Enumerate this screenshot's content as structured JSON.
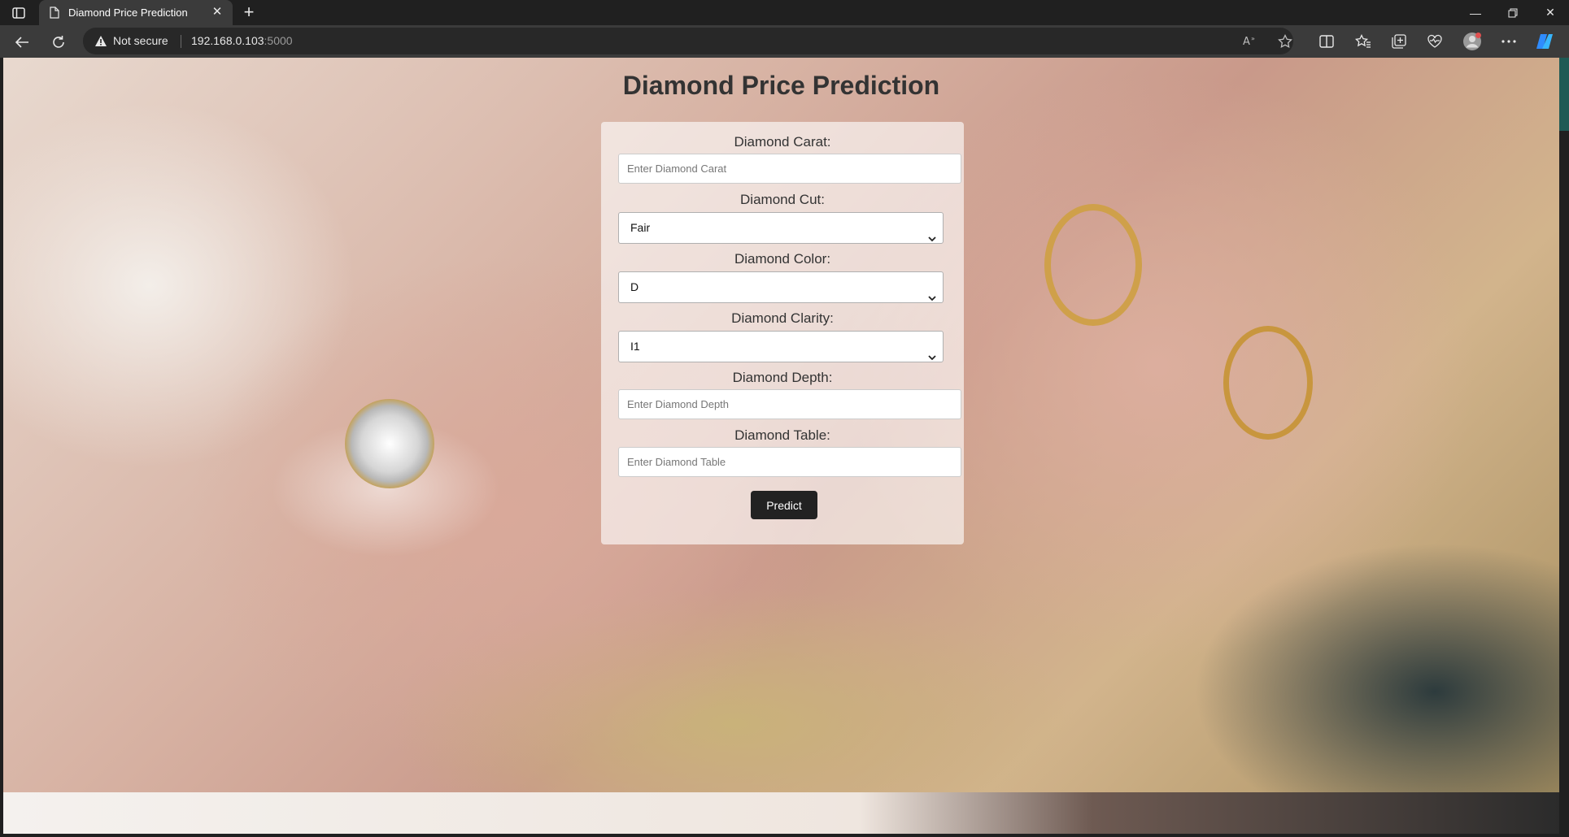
{
  "browser": {
    "tab_title": "Diamond Price Prediction",
    "security_text": "Not secure",
    "url_host": "192.168.0.103",
    "url_port": ":5000"
  },
  "page": {
    "title": "Diamond Price Prediction",
    "form": {
      "carat_label": "Diamond Carat:",
      "carat_placeholder": "Enter Diamond Carat",
      "cut_label": "Diamond Cut:",
      "cut_selected": "Fair",
      "color_label": "Diamond Color:",
      "color_selected": "D",
      "clarity_label": "Diamond Clarity:",
      "clarity_selected": "I1",
      "depth_label": "Diamond Depth:",
      "depth_placeholder": "Enter Diamond Depth",
      "table_label": "Diamond Table:",
      "table_placeholder": "Enter Diamond Table",
      "predict_label": "Predict"
    }
  },
  "icons": {
    "tab_strip": "tab-actions-icon",
    "page": "page-icon",
    "close": "close-icon",
    "new_tab": "plus-icon",
    "back": "back-arrow-icon",
    "reload": "reload-icon",
    "warning": "warning-triangle-icon",
    "read_aloud": "read-aloud-icon",
    "favorite": "star-icon",
    "split": "split-screen-icon",
    "favorites": "favorites-icon",
    "collections": "collections-icon",
    "health": "browser-essentials-icon",
    "profile": "profile-icon",
    "more": "more-icon",
    "copilot": "copilot-icon"
  },
  "colors": {
    "title_text": "#333333",
    "button_bg": "#222222",
    "chrome_dark": "#202020",
    "chrome_toolbar": "#3b3b3b"
  }
}
